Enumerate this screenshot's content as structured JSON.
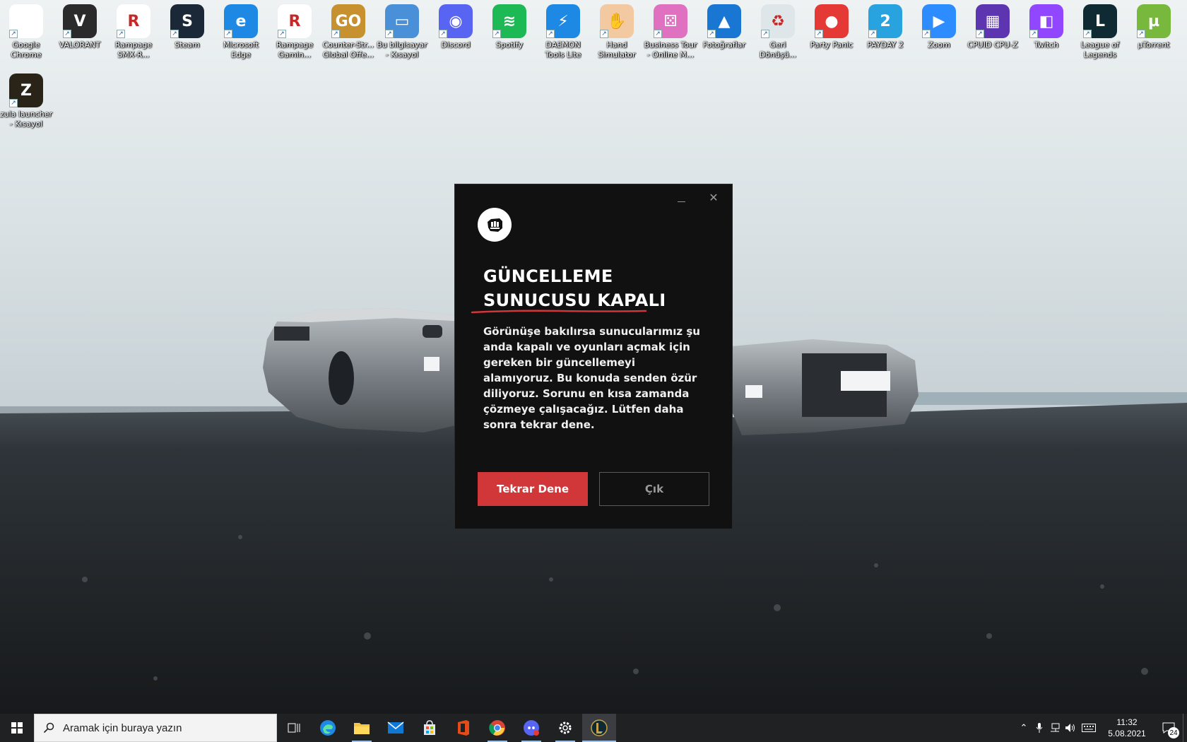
{
  "desktop": {
    "icons": [
      {
        "label": "Google Chrome",
        "icon": "chrome-icon",
        "color": "#ffffff",
        "glyph": ""
      },
      {
        "label": "VALORANT",
        "icon": "valorant-icon",
        "color": "#2b2b2b",
        "glyph": "V"
      },
      {
        "label": "Rampage SMX-R...",
        "icon": "rampage-smx-icon",
        "color": "#ffffff",
        "glyph": "R"
      },
      {
        "label": "Steam",
        "icon": "steam-icon",
        "color": "#1b2838",
        "glyph": "S"
      },
      {
        "label": "Microsoft Edge",
        "icon": "edge-icon",
        "color": "#1e88e5",
        "glyph": "e"
      },
      {
        "label": "Rampage Gamin...",
        "icon": "rampage-gaming-icon",
        "color": "#ffffff",
        "glyph": "R"
      },
      {
        "label": "Counter-Str... Global Offe...",
        "icon": "csgo-icon",
        "color": "#c8912f",
        "glyph": "GO"
      },
      {
        "label": "Bu bilgisayar - Kısayol",
        "icon": "this-pc-icon",
        "color": "#4a90d9",
        "glyph": "▭"
      },
      {
        "label": "Discord",
        "icon": "discord-icon",
        "color": "#5865f2",
        "glyph": "◉"
      },
      {
        "label": "Spotify",
        "icon": "spotify-icon",
        "color": "#1db954",
        "glyph": "≋"
      },
      {
        "label": "DAEMON Tools Lite",
        "icon": "daemon-tools-icon",
        "color": "#1e88e5",
        "glyph": "⚡"
      },
      {
        "label": "Hand Simulator",
        "icon": "hand-simulator-icon",
        "color": "#f2c9a0",
        "glyph": "✋"
      },
      {
        "label": "Business Tour - Online M...",
        "icon": "business-tour-icon",
        "color": "#e070c0",
        "glyph": "⚄"
      },
      {
        "label": "Fotoğraflar",
        "icon": "photos-icon",
        "color": "#1976d2",
        "glyph": "▲"
      },
      {
        "label": "Geri Dönüşü...",
        "icon": "recycle-bin-icon",
        "color": "#dfe6ea",
        "glyph": "♻"
      },
      {
        "label": "Party Panic",
        "icon": "party-panic-icon",
        "color": "#e53935",
        "glyph": "●"
      },
      {
        "label": "PAYDAY 2",
        "icon": "payday2-icon",
        "color": "#29a3e0",
        "glyph": "2"
      },
      {
        "label": "Zoom",
        "icon": "zoom-icon",
        "color": "#2d8cff",
        "glyph": "▶"
      },
      {
        "label": "CPUID CPU-Z",
        "icon": "cpu-z-icon",
        "color": "#5e35b1",
        "glyph": "▦"
      },
      {
        "label": "Twitch",
        "icon": "twitch-icon",
        "color": "#9146ff",
        "glyph": "◧"
      },
      {
        "label": "League of Legends",
        "icon": "league-of-legends-icon",
        "color": "#0f2a33",
        "glyph": "L"
      },
      {
        "label": "µTorrent",
        "icon": "utorrent-icon",
        "color": "#78b83c",
        "glyph": "µ"
      },
      {
        "label": "zula launcher - Kısayol",
        "icon": "zula-launcher-icon",
        "color": "#2a2418",
        "glyph": "Z"
      }
    ]
  },
  "dialog": {
    "title_line1": "GÜNCELLEME",
    "title_line2": "SUNUCUSU KAPALI",
    "body": "Görünüşe bakılırsa sunucularımız şu anda kapalı ve oyunları açmak için gereken bir güncellemeyi alamıyoruz. Bu konuda senden özür diliyoruz. Sorunu en kısa zamanda çözmeye çalışacağız. Lütfen daha sonra tekrar dene.",
    "retry_label": "Tekrar Dene",
    "quit_label": "Çık",
    "accent_color": "#d13639"
  },
  "taskbar": {
    "search_placeholder": "Aramak için buraya yazın",
    "apps": [
      {
        "name": "task-view",
        "icon": "task-view-icon"
      },
      {
        "name": "edge",
        "icon": "edge-icon"
      },
      {
        "name": "file-explorer",
        "icon": "folder-icon"
      },
      {
        "name": "mail",
        "icon": "mail-icon"
      },
      {
        "name": "store",
        "icon": "store-icon"
      },
      {
        "name": "office",
        "icon": "office-icon"
      },
      {
        "name": "chrome",
        "icon": "chrome-icon"
      },
      {
        "name": "discord",
        "icon": "discord-icon"
      },
      {
        "name": "settings",
        "icon": "gear-icon"
      },
      {
        "name": "league-client",
        "icon": "league-of-legends-icon"
      }
    ],
    "time": "11:32",
    "date": "5.08.2021",
    "notification_count": "24"
  }
}
